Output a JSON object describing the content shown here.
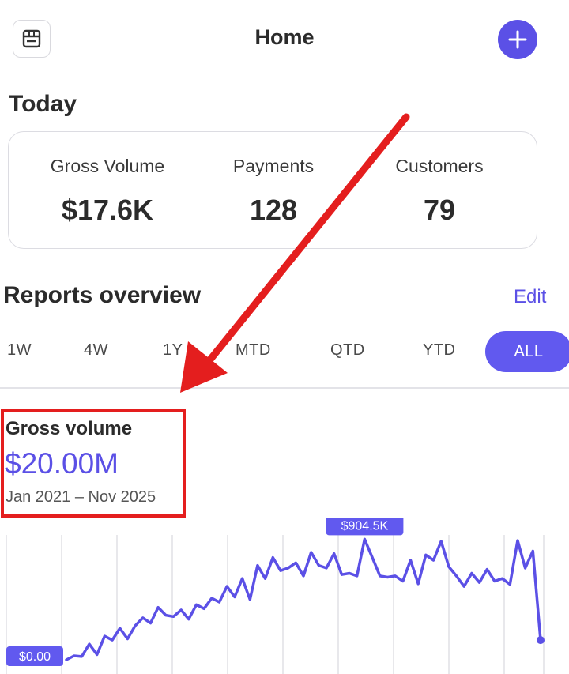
{
  "header": {
    "title": "Home",
    "store_icon": "store-icon",
    "add_icon": "plus-icon"
  },
  "today": {
    "title": "Today",
    "stats": [
      {
        "label": "Gross Volume",
        "value": "$17.6K"
      },
      {
        "label": "Payments",
        "value": "128"
      },
      {
        "label": "Customers",
        "value": "79"
      }
    ]
  },
  "reports": {
    "title": "Reports overview",
    "edit_label": "Edit",
    "tabs": [
      "1W",
      "4W",
      "1Y",
      "MTD",
      "QTD",
      "YTD",
      "ALL"
    ],
    "active_tab": "ALL"
  },
  "metric": {
    "label": "Gross volume",
    "value": "$20.00M",
    "range": "Jan 2021 – Nov 2025"
  },
  "colors": {
    "accent": "#5b50e6",
    "annotation": "#e41e1e"
  },
  "chart_data": {
    "type": "line",
    "series": [
      {
        "values": [
          0,
          30,
          25,
          120,
          40,
          180,
          150,
          240,
          160,
          260,
          320,
          280,
          400,
          340,
          330,
          380,
          310,
          420,
          390,
          470,
          440,
          560,
          480,
          620,
          460,
          720,
          620,
          780,
          680,
          700,
          740,
          640,
          820,
          720,
          700,
          810,
          650,
          660,
          640,
          920,
          780,
          640,
          630,
          640,
          600,
          760,
          580,
          800,
          760,
          904.5,
          710,
          640,
          560,
          660,
          590,
          690,
          600,
          620,
          575,
          910,
          700,
          830,
          150
        ]
      }
    ],
    "peak_label": "$904.5K",
    "min_label": "$0.00",
    "grid": true
  }
}
